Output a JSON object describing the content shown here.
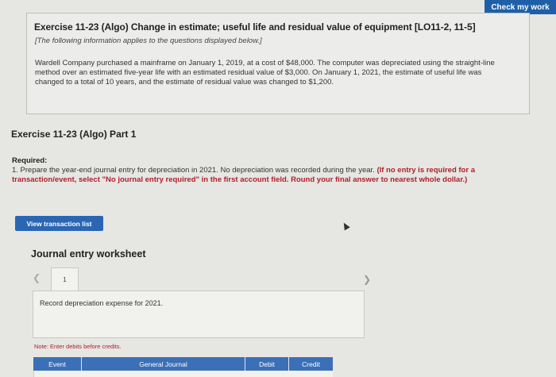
{
  "header": {
    "check_button": "Check my work"
  },
  "exercise": {
    "title": "Exercise 11-23 (Algo) Change in estimate; useful life and residual value of equipment [LO11-2, 11-5]",
    "note": "[The following information applies to the questions displayed below.]",
    "paragraph": "Wardell Company purchased a mainframe on January 1, 2019, at a cost of $48,000. The computer was depreciated using the straight-line method over an estimated five-year life with an estimated residual value of $3,000. On January 1, 2021, the estimate of useful life was changed to a total of 10 years, and the estimate of residual value was changed to $1,200."
  },
  "part": {
    "title": "Exercise 11-23 (Algo) Part 1"
  },
  "required": {
    "heading": "Required:",
    "text": "1. Prepare the year-end journal entry for depreciation in 2021. No depreciation was recorded during the year.",
    "instruction": "(If no entry is required for a transaction/event, select \"No journal entry required\" in the first account field. Round your final answer to nearest whole dollar.)"
  },
  "actions": {
    "view_transactions": "View transaction list"
  },
  "worksheet": {
    "title": "Journal entry worksheet",
    "prev_icon": "chevron-left-icon",
    "next_icon": "chevron-right-icon",
    "current_tab": "1",
    "description": "Record depreciation expense for 2021.",
    "note": "Note: Enter debits before credits.",
    "columns": [
      "Event",
      "General Journal",
      "Debit",
      "Credit"
    ]
  }
}
